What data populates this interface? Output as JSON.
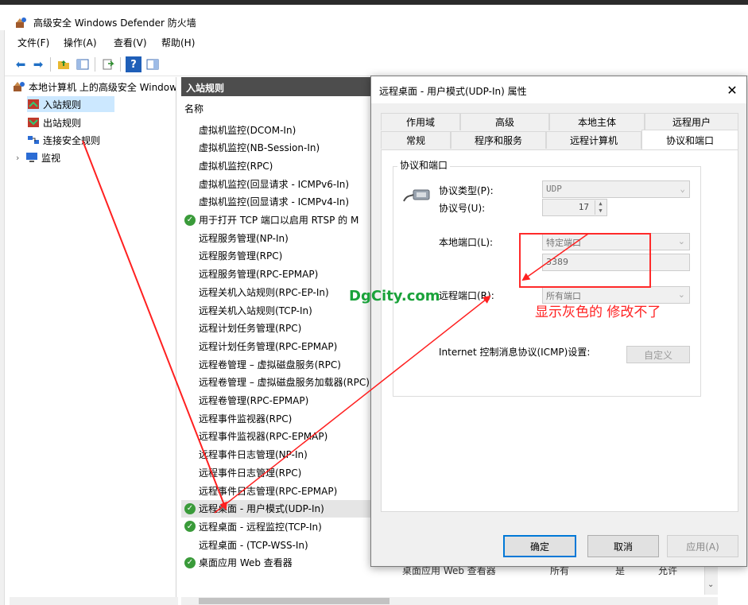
{
  "app": {
    "title": "高级安全 Windows Defender 防火墙"
  },
  "menu": {
    "items": [
      "文件(F)",
      "操作(A)",
      "查看(V)",
      "帮助(H)"
    ]
  },
  "tree": {
    "root": "本地计算机 上的高级安全 Windows Defender 防火墙",
    "items": [
      "入站规则",
      "出站规则",
      "连接安全规则",
      "监视"
    ]
  },
  "list": {
    "header": "入站规则",
    "column_name": "名称",
    "rows": [
      {
        "name": "虚拟机监控(DCOM-In)",
        "enabled": false
      },
      {
        "name": "虚拟机监控(NB-Session-In)",
        "enabled": false
      },
      {
        "name": "虚拟机监控(RPC)",
        "enabled": false
      },
      {
        "name": "虚拟机监控(回显请求 - ICMPv6-In)",
        "enabled": false
      },
      {
        "name": "虚拟机监控(回显请求 - ICMPv4-In)",
        "enabled": false
      },
      {
        "name": "用于打开 TCP 端口以启用 RTSP 的 M",
        "enabled": true
      },
      {
        "name": "远程服务管理(NP-In)",
        "enabled": false
      },
      {
        "name": "远程服务管理(RPC)",
        "enabled": false
      },
      {
        "name": "远程服务管理(RPC-EPMAP)",
        "enabled": false
      },
      {
        "name": "远程关机入站规则(RPC-EP-In)",
        "enabled": false
      },
      {
        "name": "远程关机入站规则(TCP-In)",
        "enabled": false
      },
      {
        "name": "远程计划任务管理(RPC)",
        "enabled": false
      },
      {
        "name": "远程计划任务管理(RPC-EPMAP)",
        "enabled": false
      },
      {
        "name": "远程卷管理 – 虚拟磁盘服务(RPC)",
        "enabled": false
      },
      {
        "name": "远程卷管理 – 虚拟磁盘服务加载器(RPC)",
        "enabled": false
      },
      {
        "name": "远程卷管理(RPC-EPMAP)",
        "enabled": false
      },
      {
        "name": "远程事件监视器(RPC)",
        "enabled": false
      },
      {
        "name": "远程事件监视器(RPC-EPMAP)",
        "enabled": false
      },
      {
        "name": "远程事件日志管理(NP-In)",
        "enabled": false
      },
      {
        "name": "远程事件日志管理(RPC)",
        "enabled": false
      },
      {
        "name": "远程事件日志管理(RPC-EPMAP)",
        "enabled": false
      },
      {
        "name": "远程桌面 - 用户模式(UDP-In)",
        "enabled": true,
        "selected": true
      },
      {
        "name": "远程桌面 - 远程监控(TCP-In)",
        "enabled": true
      },
      {
        "name": "远程桌面 - (TCP-WSS-In)",
        "enabled": false
      },
      {
        "name": "桌面应用 Web 查看器",
        "enabled": true
      }
    ],
    "extra_row": {
      "group": "桌面应用 Web 查看器",
      "profile": "所有",
      "enabled": "是",
      "action": "允许"
    }
  },
  "dialog": {
    "title": "远程桌面 - 用户模式(UDP-In) 属性",
    "tabs_top": [
      "作用域",
      "高级",
      "本地主体",
      "远程用户"
    ],
    "tabs_bottom": [
      "常规",
      "程序和服务",
      "远程计算机",
      "协议和端口"
    ],
    "group_label": "协议和端口",
    "protocol_type_label": "协议类型(P):",
    "protocol_type_value": "UDP",
    "protocol_number_label": "协议号(U):",
    "protocol_number_value": "17",
    "local_port_label": "本地端口(L):",
    "local_port_value": "特定端口",
    "local_port_number": "3389",
    "remote_port_label": "远程端口(R):",
    "remote_port_value": "所有端口",
    "icmp_label": "Internet 控制消息协议(ICMP)设置:",
    "customize_button": "自定义",
    "ok_button": "确定",
    "cancel_button": "取消",
    "apply_button": "应用(A)"
  },
  "annotation": {
    "text": "显示灰色的 修改不了",
    "color": "#ff2020"
  },
  "watermark": {
    "text": "DgCity.com",
    "color": "#1aa23a"
  },
  "colors": {
    "enabled_check": "#3a9b3a",
    "list_header_bg": "#4d4d4d",
    "selection": "#cce8ff"
  }
}
